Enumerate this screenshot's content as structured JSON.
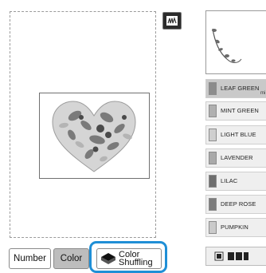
{
  "buttons": {
    "number": "Number",
    "color": "Color",
    "color_shuffling_line1": "Color",
    "color_shuffling_line2": "Shuffling"
  },
  "thread_colors": [
    {
      "name": "LEAF GREEN",
      "sub": "mi",
      "swatch": "#8c8c8c",
      "selected": true
    },
    {
      "name": "MINT GREEN",
      "swatch": "#b0b0b0"
    },
    {
      "name": "LIGHT BLUE",
      "swatch": "#cfcfcf"
    },
    {
      "name": "LAVENDER",
      "swatch": "#a9a9a9"
    },
    {
      "name": "LILAC",
      "swatch": "#6e6e6e"
    },
    {
      "name": "DEEP ROSE",
      "swatch": "#7c7c7c"
    },
    {
      "name": "PUMPKIN",
      "swatch": "#cacaca"
    }
  ],
  "icons": {
    "preview_toggle": "preview-toggle-icon",
    "shuffle": "spool-icon",
    "scroll": "page-view-icon"
  },
  "colors": {
    "highlight": "#1f8fd6",
    "selected_button": "#bdbdbd"
  }
}
